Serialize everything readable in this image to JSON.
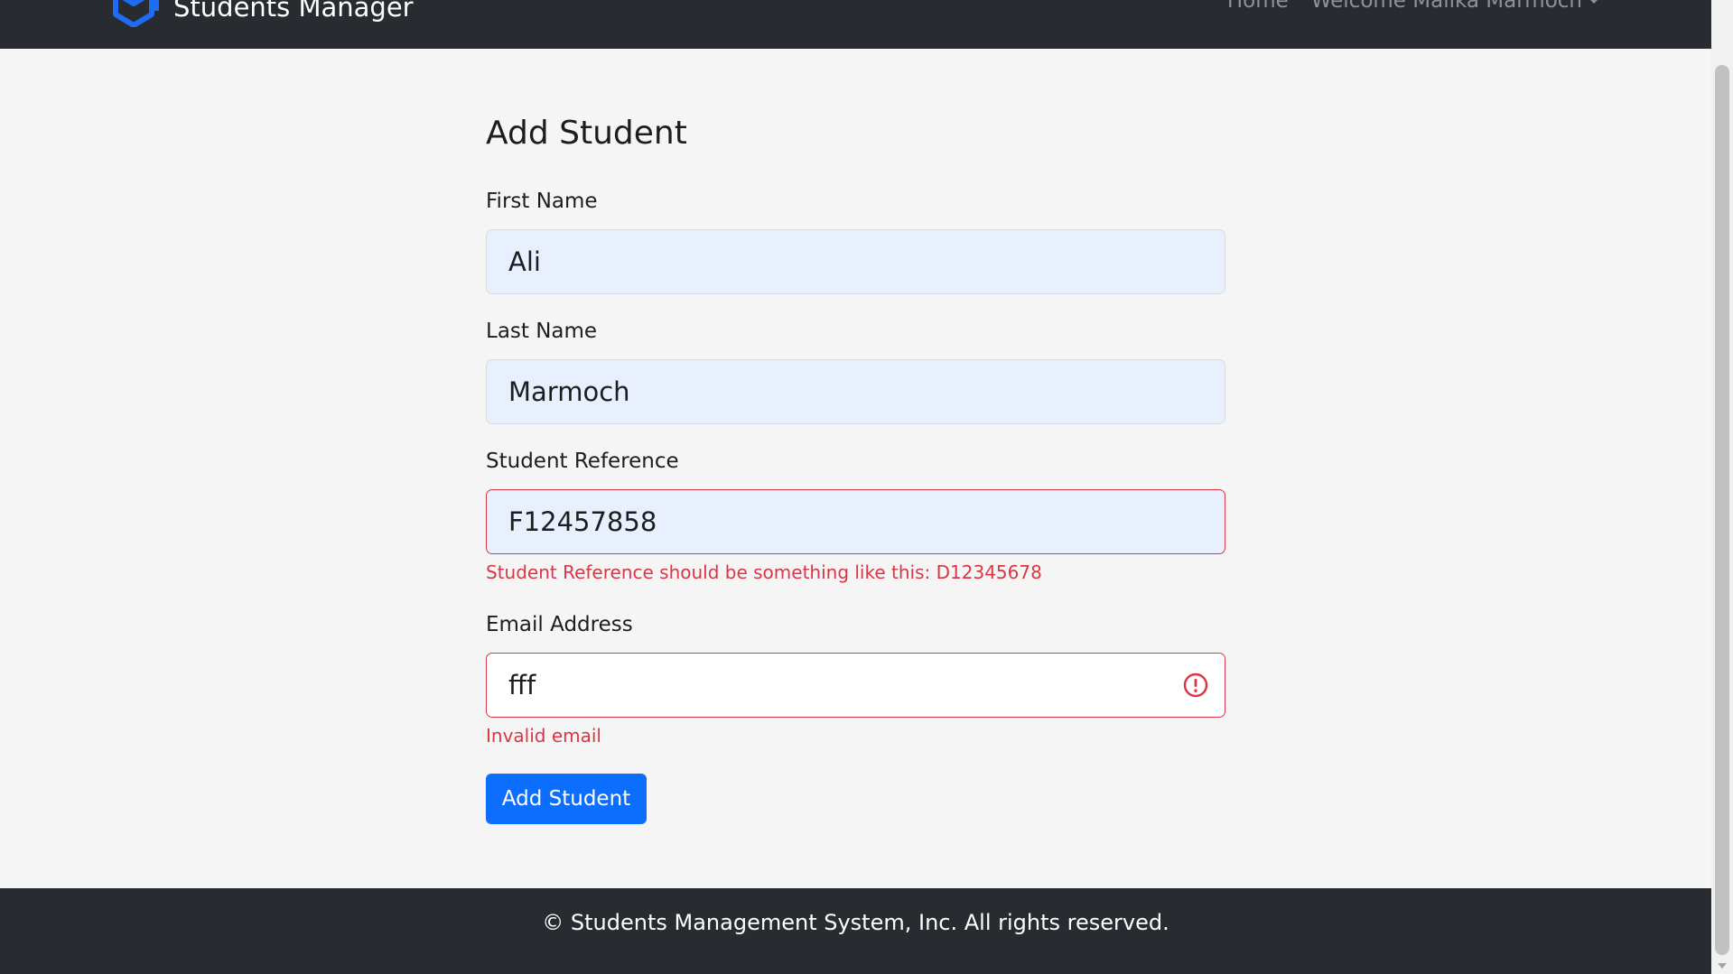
{
  "navbar": {
    "brand": "Students Manager",
    "home": "Home",
    "welcome": "Welcome Malika Marmoch",
    "brand_icon": "box-logo-icon",
    "dropdown_icon": "caret-down-icon"
  },
  "form": {
    "title": "Add Student",
    "first_name": {
      "label": "First Name",
      "value": "Ali"
    },
    "last_name": {
      "label": "Last Name",
      "value": "Marmoch"
    },
    "student_reference": {
      "label": "Student Reference",
      "value": "F12457858",
      "error": "Student Reference should be something like this: D12345678"
    },
    "email": {
      "label": "Email Address",
      "value": "fff",
      "error": "Invalid email",
      "error_icon": "alert-circle-icon"
    },
    "submit": "Add Student"
  },
  "footer": {
    "text": "© Students Management System, Inc. All rights reserved."
  },
  "colors": {
    "navbar_bg": "#282c31",
    "page_bg": "#f5f5f5",
    "primary": "#0d6efd",
    "danger": "#dc3545",
    "autofill_bg": "#e8f0fe"
  }
}
